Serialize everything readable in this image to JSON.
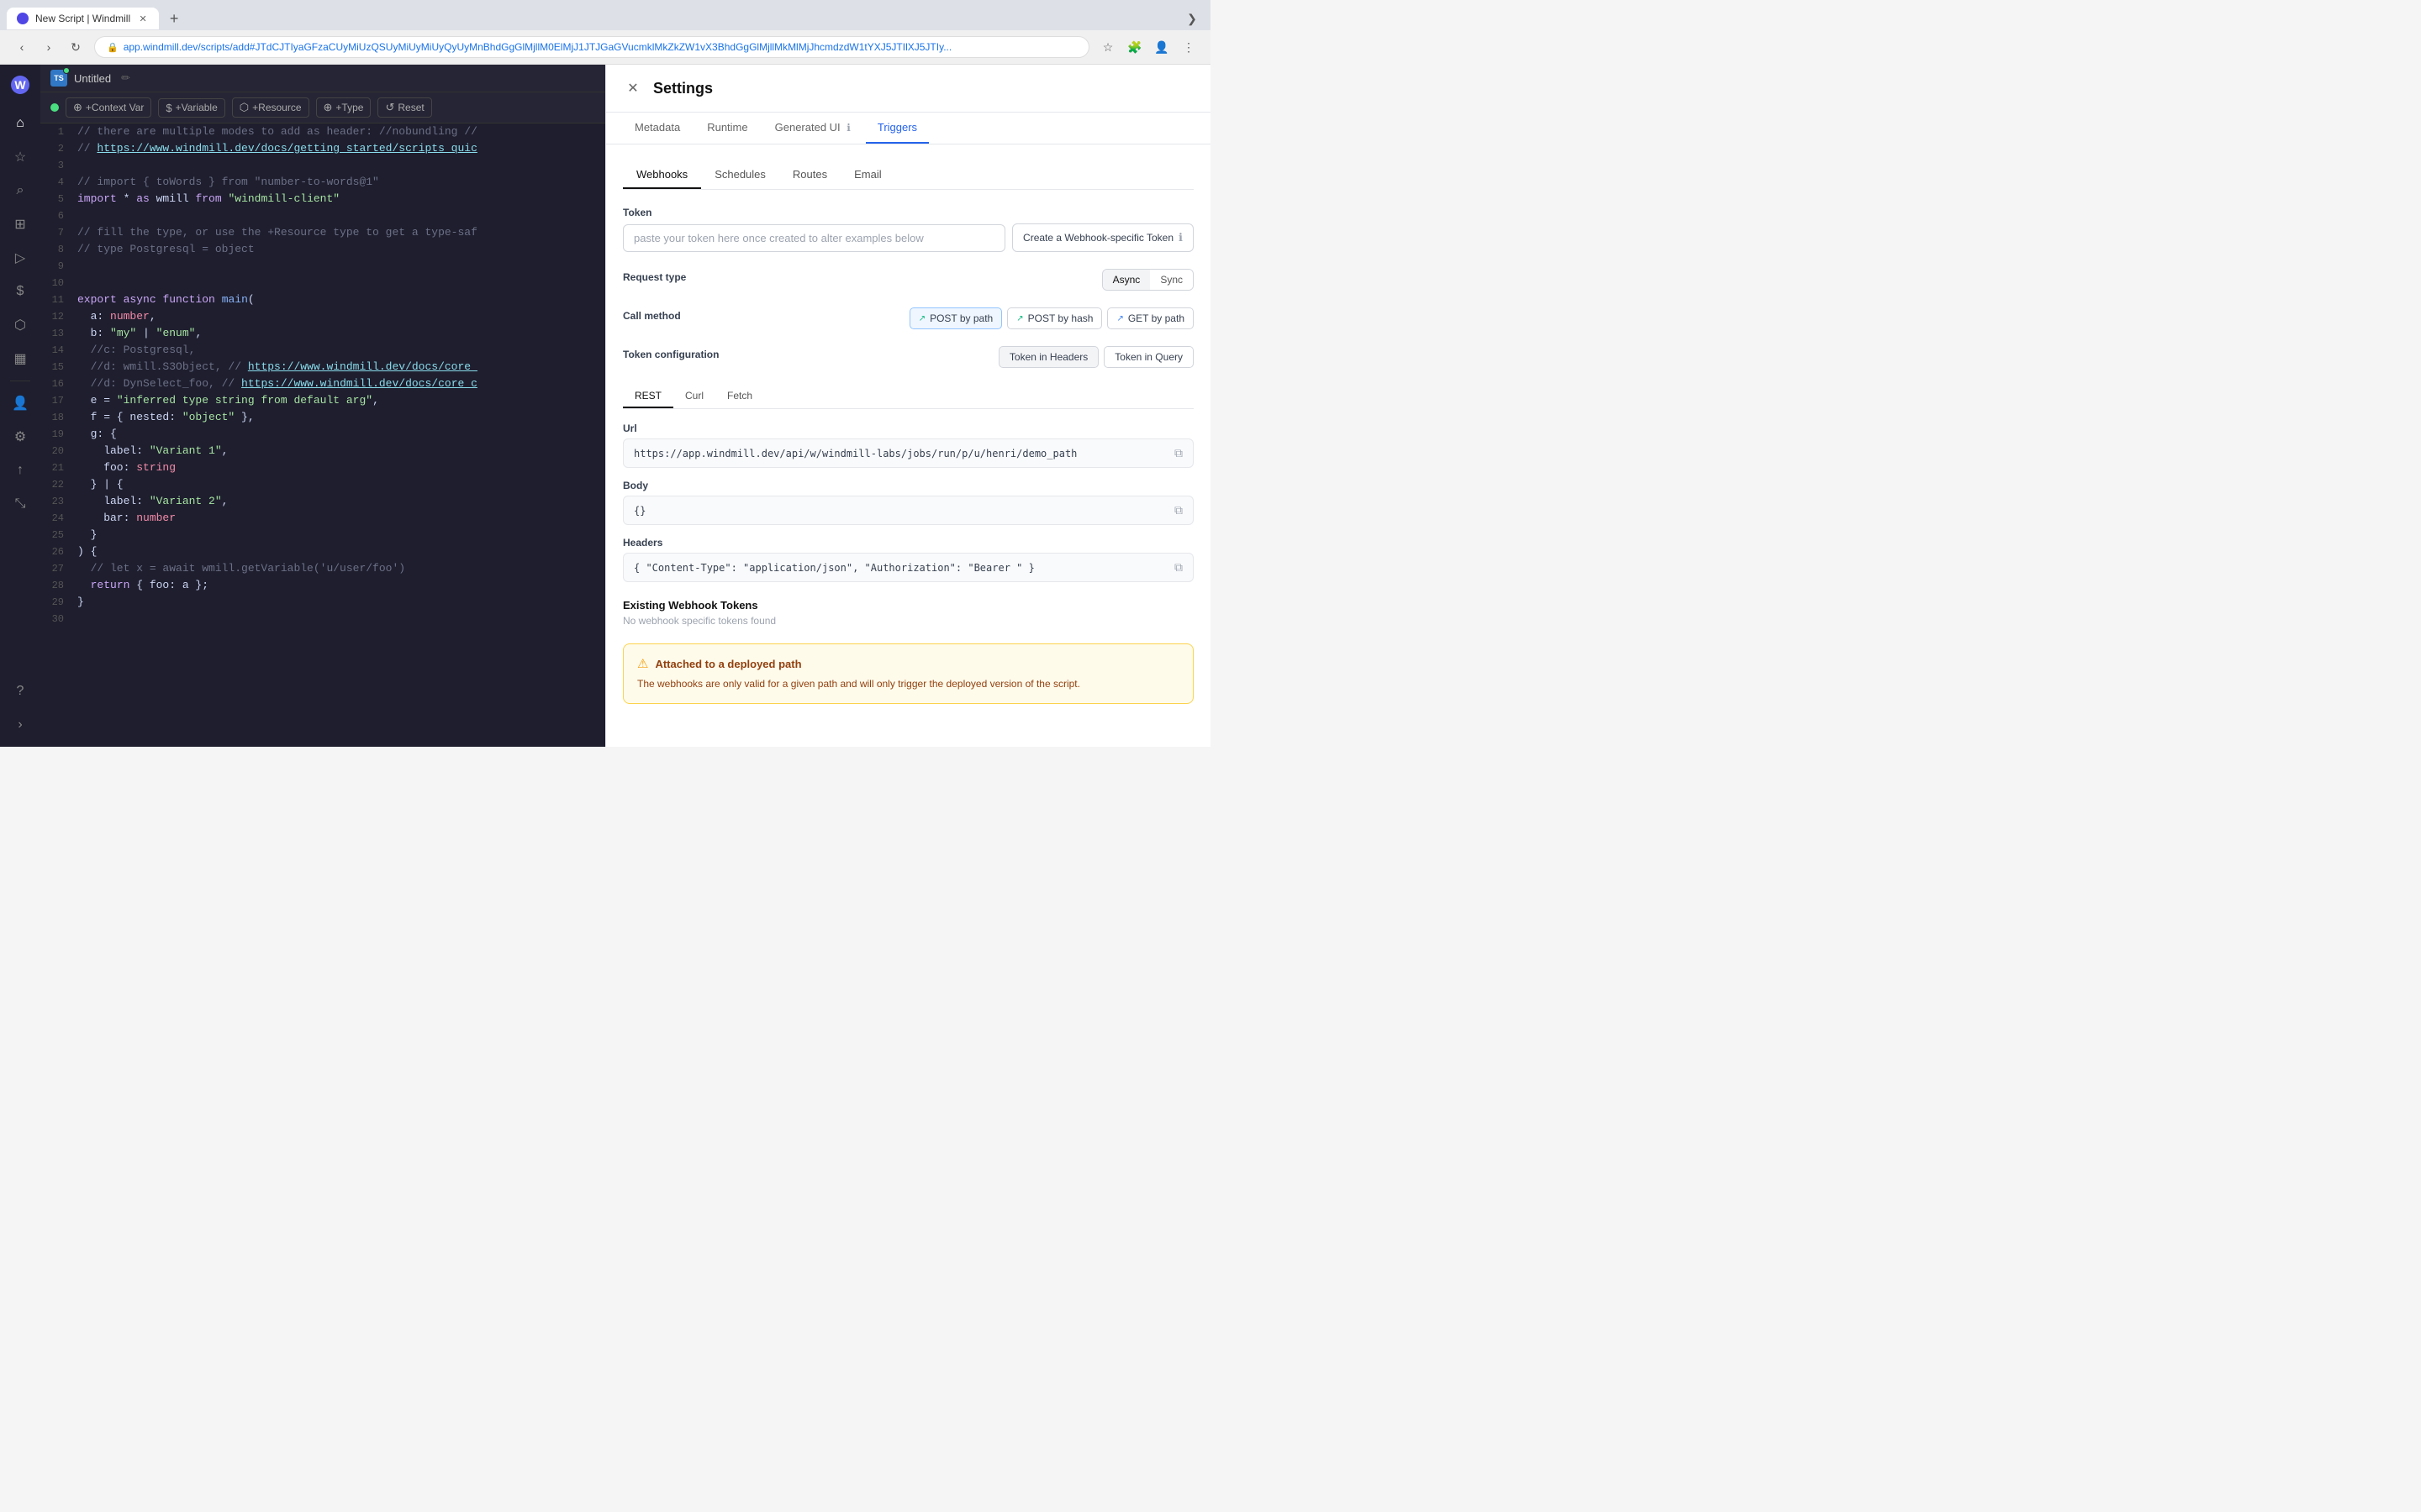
{
  "browser": {
    "tab_title": "New Script | Windmill",
    "url": "app.windmill.dev/scripts/add#JTdCJTIyaGFzaCUyMiUzQSUyMiUyMiUyQyUyMnBhdGgGlMjllM0ElMjJ1JTJGaGVucmklMkZkZW1vX3BhdGgGlMjllMkMlMjJhcmdzdW1tYXJ5JTIlXJ5JTIy...",
    "new_tab_label": "+",
    "chevron_label": "❯"
  },
  "editor": {
    "filename": "Untitled",
    "toolbar": {
      "context_var": "+Context Var",
      "variable": "+Variable",
      "resource": "+Resource",
      "type": "+Type",
      "reset": "Reset"
    },
    "lines": [
      {
        "num": 1,
        "text": "// there are multiple modes to add as header: //nobundling //"
      },
      {
        "num": 2,
        "text": "// https://www.windmill.dev/docs/getting_started/scripts_quic"
      },
      {
        "num": 3,
        "text": ""
      },
      {
        "num": 4,
        "text": "// import { toWords } from \"number-to-words@1\""
      },
      {
        "num": 5,
        "text": "import * as wmill from \"windmill-client\""
      },
      {
        "num": 6,
        "text": ""
      },
      {
        "num": 7,
        "text": "// fill the type, or use the +Resource type to get a type-saf"
      },
      {
        "num": 8,
        "text": "// type Postgresql = object"
      },
      {
        "num": 9,
        "text": ""
      },
      {
        "num": 10,
        "text": ""
      },
      {
        "num": 11,
        "text": "export async function main("
      },
      {
        "num": 12,
        "text": "  a: number,"
      },
      {
        "num": 13,
        "text": "  b: \"my\" | \"enum\","
      },
      {
        "num": 14,
        "text": "  //c: Postgresql,"
      },
      {
        "num": 15,
        "text": "  //d: wmill.S3Object, // https://www.windmill.dev/docs/core_"
      },
      {
        "num": 16,
        "text": "  //d: DynSelect_foo, // https://www.windmill.dev/docs/core_c"
      },
      {
        "num": 17,
        "text": "  e = \"inferred type string from default arg\","
      },
      {
        "num": 18,
        "text": "  f = { nested: \"object\" },"
      },
      {
        "num": 19,
        "text": "  g: {"
      },
      {
        "num": 20,
        "text": "    label: \"Variant 1\","
      },
      {
        "num": 21,
        "text": "    foo: string"
      },
      {
        "num": 22,
        "text": "  } | {"
      },
      {
        "num": 23,
        "text": "    label: \"Variant 2\","
      },
      {
        "num": 24,
        "text": "    bar: number"
      },
      {
        "num": 25,
        "text": "  }"
      },
      {
        "num": 26,
        "text": ") {"
      },
      {
        "num": 27,
        "text": "  // let x = await wmill.getVariable('u/user/foo')"
      },
      {
        "num": 28,
        "text": "  return { foo: a };"
      },
      {
        "num": 29,
        "text": "}"
      },
      {
        "num": 30,
        "text": ""
      }
    ]
  },
  "settings": {
    "title": "Settings",
    "tabs": [
      "Metadata",
      "Runtime",
      "Generated UI",
      "Triggers"
    ],
    "active_tab": "Triggers",
    "generated_ui_info": true,
    "sub_tabs": [
      "Webhooks",
      "Schedules",
      "Routes",
      "Email"
    ],
    "active_sub_tab": "Webhooks",
    "token_label": "Token",
    "token_placeholder": "paste your token here once created to alter examples below",
    "create_token_btn": "Create a Webhook-specific Token",
    "request_type_label": "Request type",
    "request_type_options": [
      "Async",
      "Sync"
    ],
    "active_request_type": "Async",
    "call_method_label": "Call method",
    "call_methods": [
      {
        "label": "POST by path",
        "icon": "↗",
        "active": true,
        "type": "post"
      },
      {
        "label": "POST by hash",
        "icon": "↗",
        "active": false,
        "type": "post"
      },
      {
        "label": "GET by path",
        "icon": "↗",
        "active": false,
        "type": "get"
      }
    ],
    "token_config_label": "Token configuration",
    "token_config_options": [
      "Token in Headers",
      "Token in Query"
    ],
    "rest_tabs": [
      "REST",
      "Curl",
      "Fetch"
    ],
    "active_rest_tab": "REST",
    "url_label": "Url",
    "url_value": "https://app.windmill.dev/api/w/windmill-labs/jobs/run/p/u/henri/demo_path",
    "body_label": "Body",
    "body_value": "{}",
    "headers_label": "Headers",
    "headers_value": "{ \"Content-Type\": \"application/json\", \"Authorization\": \"Bearer \" }",
    "existing_tokens_title": "Existing Webhook Tokens",
    "existing_tokens_empty": "No webhook specific tokens found",
    "warning_title": "Attached to a deployed path",
    "warning_text": "The webhooks are only valid for a given path and will only trigger the deployed version of the script."
  },
  "sidebar": {
    "logo": "W",
    "icons": [
      {
        "name": "home",
        "symbol": "⌂",
        "active": false
      },
      {
        "name": "star",
        "symbol": "☆",
        "active": false
      },
      {
        "name": "search",
        "symbol": "⌕",
        "active": false
      },
      {
        "name": "grid",
        "symbol": "⊞",
        "active": false
      },
      {
        "name": "play",
        "symbol": "▷",
        "active": false
      },
      {
        "name": "dollar",
        "symbol": "$",
        "active": false
      },
      {
        "name": "puzzle",
        "symbol": "⬡",
        "active": false
      },
      {
        "name": "calendar",
        "symbol": "▦",
        "active": false
      },
      {
        "name": "users",
        "symbol": "👤",
        "active": false
      },
      {
        "name": "settings",
        "symbol": "⚙",
        "active": false
      },
      {
        "name": "upload",
        "symbol": "↑",
        "active": false
      },
      {
        "name": "expand",
        "symbol": "⤡",
        "active": false
      }
    ],
    "bottom_icons": [
      {
        "name": "question",
        "symbol": "?",
        "active": false
      },
      {
        "name": "chevron-down",
        "symbol": "›",
        "active": false
      }
    ]
  }
}
